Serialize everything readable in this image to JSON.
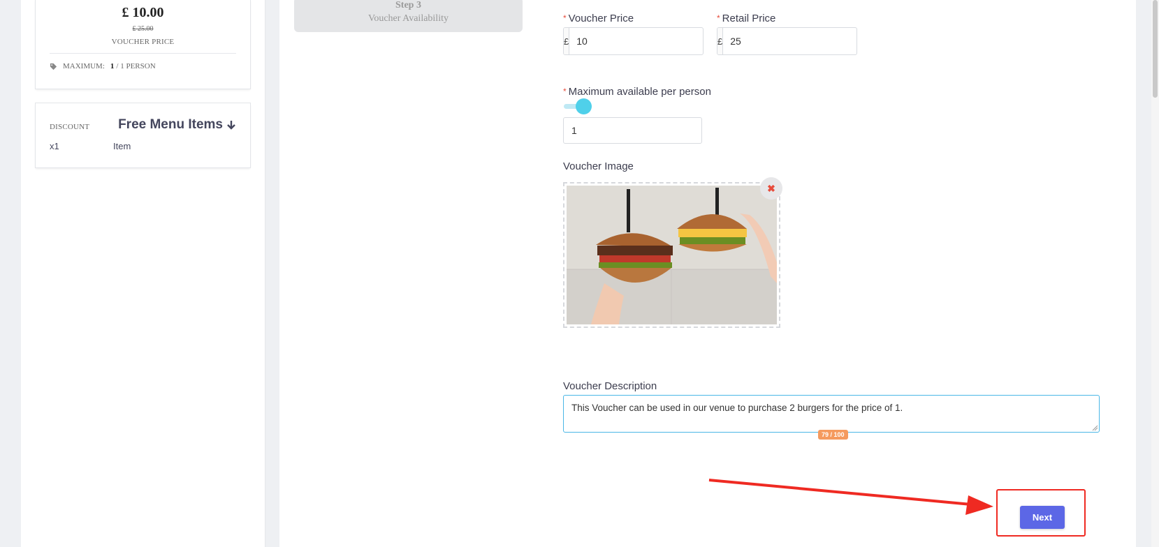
{
  "summary": {
    "voucher_price": "£ 10.00",
    "retail_price": "£ 25.00",
    "voucher_price_label": "VOUCHER PRICE",
    "max_label": "MAXIMUM:",
    "max_value": "1",
    "max_unit": "/ 1 PERSON"
  },
  "discount": {
    "label": "DISCOUNT",
    "title": "Free Menu Items",
    "quantity": "x1",
    "item": "Item"
  },
  "steps": {
    "title": "Step 3",
    "subtitle": "Voucher Availability"
  },
  "form": {
    "voucher_price_label": "Voucher Price",
    "voucher_price_currency": "£",
    "voucher_price_value": "10",
    "retail_price_label": "Retail Price",
    "retail_price_currency": "£",
    "retail_price_value": "25",
    "max_per_person_label": "Maximum available per person",
    "max_per_person_value": "1",
    "image_label": "Voucher Image",
    "remove_icon": "✖",
    "description_label": "Voucher Description",
    "description_value": "This Voucher can be used in our venue to purchase 2 burgers for the price of 1.",
    "char_counter": "79 / 100",
    "next_label": "Next"
  },
  "colors": {
    "accent": "#5c67e6",
    "slider": "#4fd0ea",
    "required": "#e74c3c",
    "annotation": "#ef2a22",
    "counter": "#f59a5e"
  }
}
